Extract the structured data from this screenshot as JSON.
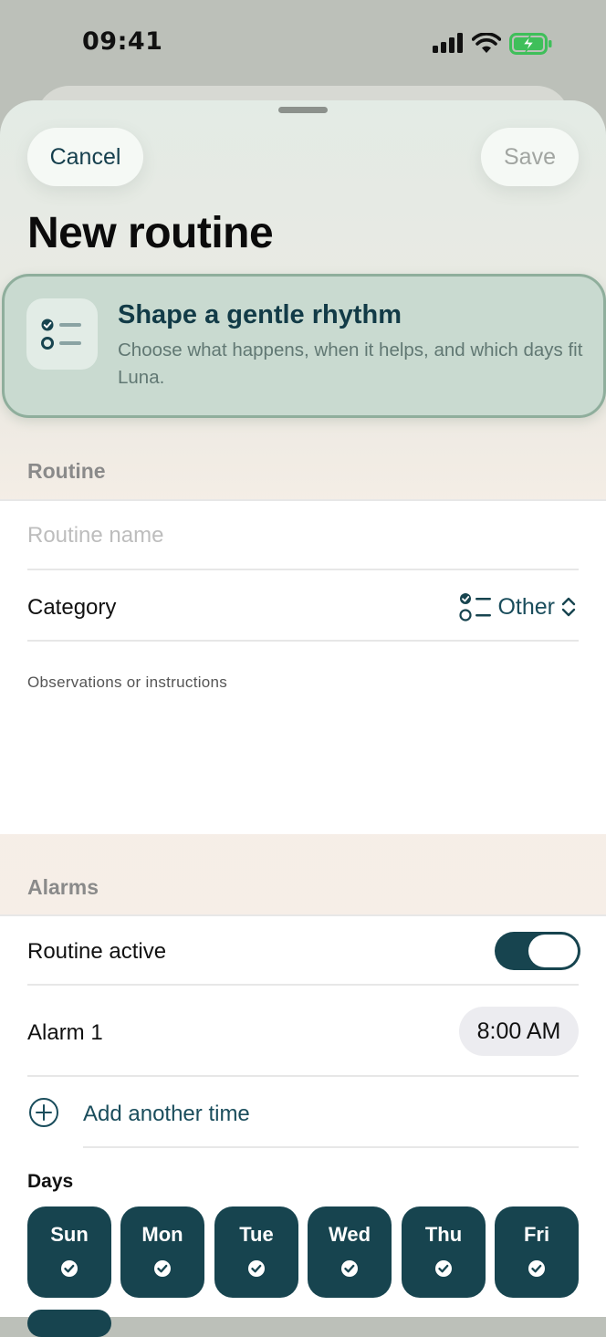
{
  "status_bar": {
    "time": "09:41"
  },
  "nav": {
    "cancel_label": "Cancel",
    "save_label": "Save",
    "title": "New routine"
  },
  "hero": {
    "icon": "checklist-icon",
    "title": "Shape a gentle rhythm",
    "subtitle": "Choose what happens, when it helps, and which days fit Luna."
  },
  "routine_section": {
    "header": "Routine",
    "name_placeholder": "Routine name",
    "category_label": "Category",
    "category_value": "Other",
    "notes_placeholder": "Observations or instructions"
  },
  "alarms_section": {
    "header": "Alarms",
    "active_label": "Routine active",
    "active": true,
    "alarms": [
      {
        "label": "Alarm 1",
        "time": "8:00 AM"
      }
    ],
    "add_label": "Add another time"
  },
  "days": {
    "label": "Days",
    "items": [
      {
        "name": "Sun",
        "selected": true
      },
      {
        "name": "Mon",
        "selected": true
      },
      {
        "name": "Tue",
        "selected": true
      },
      {
        "name": "Wed",
        "selected": true
      },
      {
        "name": "Thu",
        "selected": true
      },
      {
        "name": "Fri",
        "selected": true
      }
    ]
  },
  "colors": {
    "accent": "#17444f",
    "hero_bg": "#c9dad0",
    "hero_border": "#8fae9c",
    "battery_green": "#3fbf5a"
  }
}
